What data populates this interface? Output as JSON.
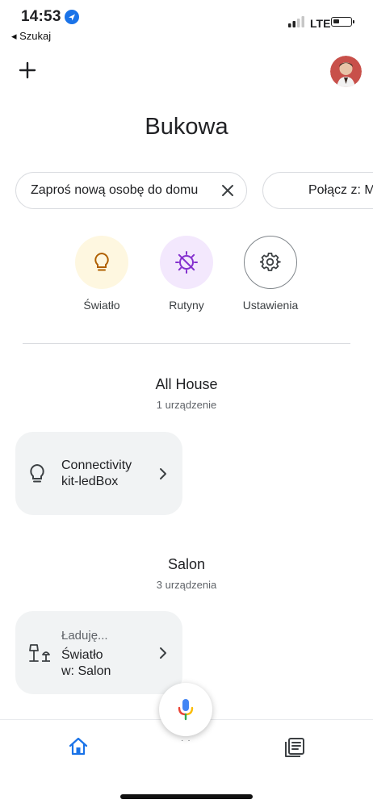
{
  "status_bar": {
    "time": "14:53",
    "back_label": "◂ Szukaj",
    "network": "LTE"
  },
  "header": {
    "home_name": "Bukowa"
  },
  "chips": [
    {
      "label": "Zaproś nową osobę do domu"
    },
    {
      "label": "Połącz z: M"
    }
  ],
  "quick_actions": [
    {
      "label": "Światło",
      "icon": "lightbulb-icon",
      "color": "#fef7e0"
    },
    {
      "label": "Rutyny",
      "icon": "routine-icon",
      "color": "#f3e8fd"
    },
    {
      "label": "Ustawienia",
      "icon": "gear-icon",
      "color": "#ffffff"
    }
  ],
  "rooms": [
    {
      "title": "All House",
      "count": "1 urządzenie",
      "devices": [
        {
          "name_line1": "Connectivity",
          "name_line2": "kit-ledBox",
          "icon": "lightbulb-icon"
        }
      ]
    },
    {
      "title": "Salon",
      "count": "3 urządzenia",
      "devices": [
        {
          "status": "Ładuję...",
          "name_line1": "Światło",
          "name_line2": "w: Salon",
          "icon": "lamps-icon"
        }
      ]
    }
  ],
  "bottom_nav": {
    "items": [
      "home-icon",
      "feed-icon"
    ],
    "active_color": "#1a73e8",
    "mic_icon": "microphone-icon"
  }
}
